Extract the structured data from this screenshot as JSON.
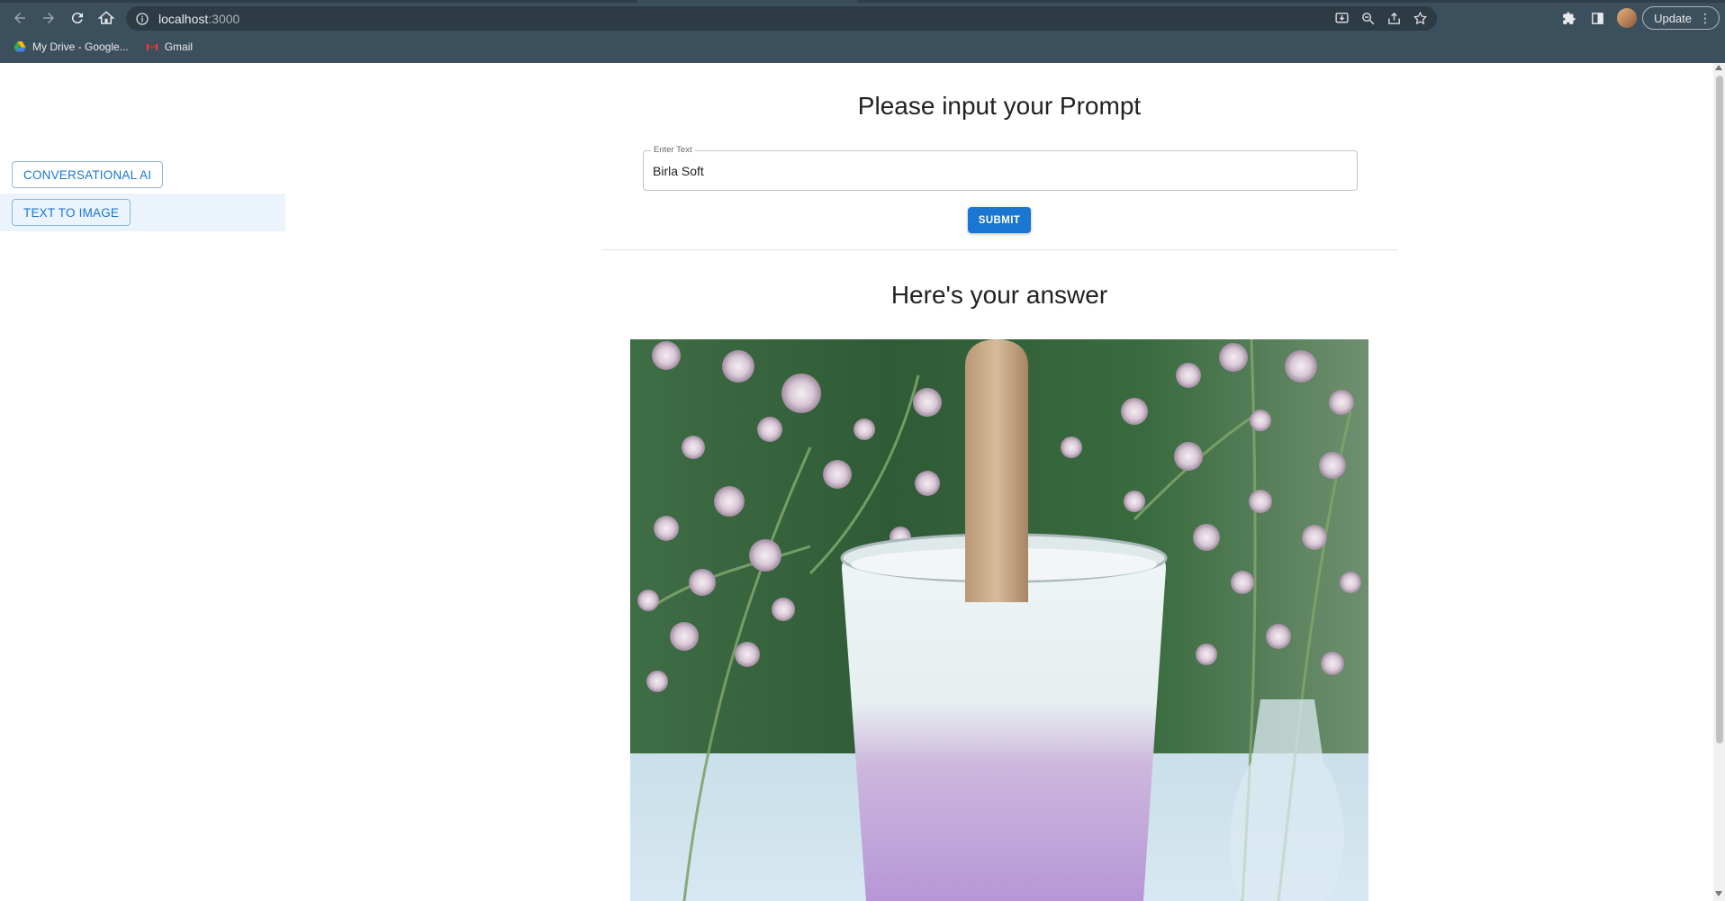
{
  "browser": {
    "url_host": "localhost",
    "url_port": ":3000",
    "update_label": "Update",
    "bookmarks": [
      {
        "label": "My Drive - Google...",
        "icon": "google-drive-icon"
      },
      {
        "label": "Gmail",
        "icon": "gmail-icon"
      }
    ]
  },
  "sidebar": {
    "items": [
      {
        "label": "CONVERSATIONAL AI",
        "selected": false
      },
      {
        "label": "TEXT TO IMAGE",
        "selected": true
      }
    ]
  },
  "main": {
    "prompt_title": "Please input your Prompt",
    "input_label": "Enter Text",
    "input_value": "Birla Soft",
    "submit_label": "SUBMIT",
    "answer_title": "Here's your answer"
  },
  "colors": {
    "primary": "#1976d2",
    "chrome_bg": "#3c4f5c",
    "selected_bg": "#ebf3fc"
  }
}
